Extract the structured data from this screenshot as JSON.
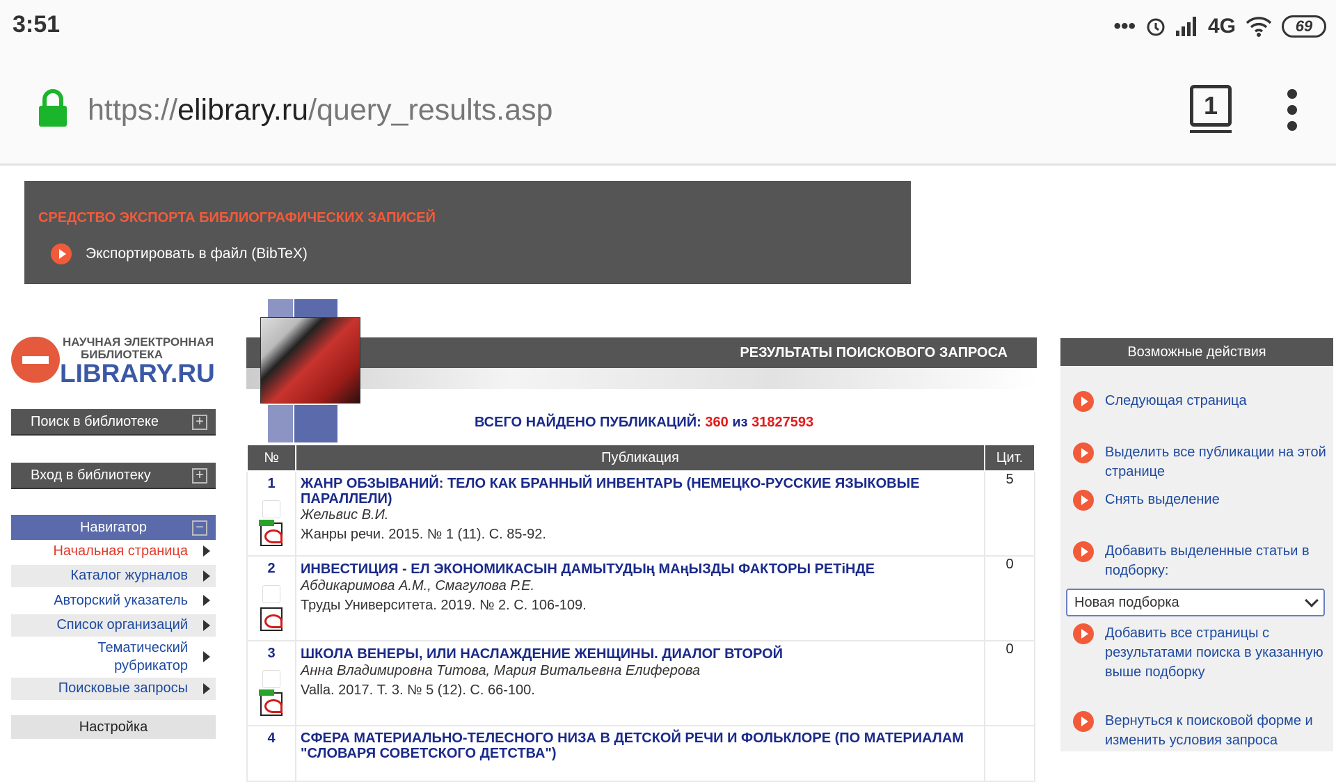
{
  "status_bar": {
    "time": "3:51",
    "network": "4G",
    "battery": "69",
    "dots": "•••"
  },
  "browser": {
    "url_scheme": "https://",
    "url_domain": "elibrary.ru",
    "url_path": "/query_results.asp",
    "tab_count": "1"
  },
  "export": {
    "title": "СРЕДСТВО ЭКСПОРТА БИБЛИОГРАФИЧЕСКИХ ЗАПИСЕЙ",
    "link": "Экспортировать в файл (BibTeX)"
  },
  "logo": {
    "line1": "НАУЧНАЯ ЭЛЕКТРОННАЯ",
    "line2": "БИБЛИОТЕКА",
    "line3": "LIBRARY.RU"
  },
  "sidebar": {
    "search": "Поиск в библиотеке",
    "login": "Вход в библиотеку",
    "navigator": "Навигатор",
    "items": [
      {
        "label": "Начальная страница"
      },
      {
        "label": "Каталог журналов"
      },
      {
        "label": "Авторский указатель"
      },
      {
        "label": "Список организаций"
      },
      {
        "label": "Тематический рубрикатор"
      },
      {
        "label": "Поисковые запросы"
      }
    ],
    "settings": "Настройка"
  },
  "results": {
    "header": "РЕЗУЛЬТАТЫ ПОИСКОВОГО ЗАПРОСА",
    "total_label": "ВСЕГО НАЙДЕНО ПУБЛИКАЦИЙ:",
    "total_found": "360",
    "total_of": "из",
    "total_all": "31827593",
    "columns": {
      "num": "№",
      "pub": "Публикация",
      "cit": "Цит."
    },
    "rows": [
      {
        "num": "1",
        "title": "ЖАНР ОБЗЫВАНИЙ: ТЕЛО КАК БРАННЫЙ ИНВЕНТАРЬ (НЕМЕЦКО-РУССКИЕ ЯЗЫКОВЫЕ ПАРАЛЛЕЛИ)",
        "authors": "Жельвис В.И.",
        "source": "Жанры речи. 2015. № 1 (11). С. 85-92.",
        "cit": "5"
      },
      {
        "num": "2",
        "title": "ИНВЕСТИЦИЯ - ЕЛ ЭКОНОМИКАСЫН ДАМЫТУДЫң МАңЫЗДЫ ФАКТОРЫ РЕТiНДЕ",
        "authors": "Абдикаримова А.М., Смагулова Р.Е.",
        "source": "Труды Университета. 2019. № 2. С. 106-109.",
        "cit": "0"
      },
      {
        "num": "3",
        "title": "ШКОЛА ВЕНЕРЫ, ИЛИ НАСЛАЖДЕНИЕ ЖЕНЩИНЫ. ДИАЛОГ ВТОРОЙ",
        "authors": "Анна Владимировна Титова, Мария Витальевна Елиферова",
        "source": "Valla. 2017. Т. 3. № 5 (12). С. 66-100.",
        "cit": "0"
      },
      {
        "num": "4",
        "title": "СФЕРА МАТЕРИАЛЬНО-ТЕЛЕСНОГО НИЗА В ДЕТСКОЙ РЕЧИ И ФОЛЬКЛОРЕ (ПО МАТЕРИАЛАМ \"СЛОВАРЯ СОВЕТСКОГО ДЕТСТВА\")",
        "authors": "",
        "source": "",
        "cit": ""
      }
    ]
  },
  "actions": {
    "header": "Возможные действия",
    "next": "Следующая страница",
    "select_all": "Выделить все публикации на этой странице",
    "deselect": "Снять выделение",
    "add_selected": "Добавить выделенные статьи в подборку:",
    "select_value": "Новая подборка",
    "add_all": "Добавить все страницы с результатами поиска в указанную выше подборку",
    "back": "Вернуться к поисковой форме и изменить условия запроса"
  }
}
